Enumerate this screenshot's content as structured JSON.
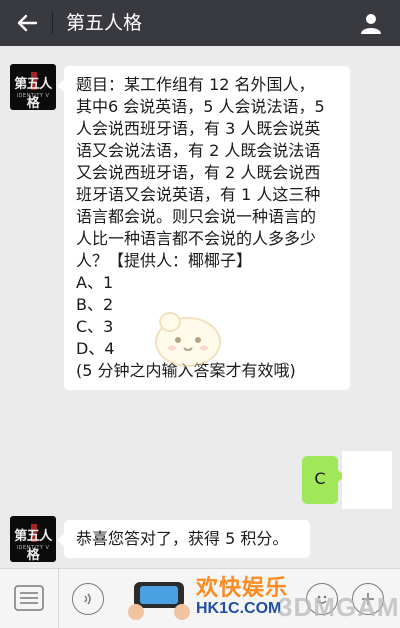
{
  "header": {
    "title": "第五人格",
    "back_icon": "arrow-left-icon",
    "profile_icon": "person-icon"
  },
  "messages": [
    {
      "side": "left",
      "sender_logo": "第五人格",
      "sender_logo_sub": "IDENTITY V",
      "lines": [
        "题目：某工作组有 12 名外国人，",
        "其中6 会说英语，5 人会说法语，5",
        "人会说西班牙语，有 3 人既会说英",
        "语又会说法语，有 2 人既会说法语",
        "又会说西班牙语，有 2 人既会说西",
        "班牙语又会说英语，有 1 人这三种",
        "语言都会说。则只会说一种语言的",
        "人比一种语言都不会说的人多多少",
        "人？【提供人：椰椰子】",
        "A、1",
        "B、2",
        "C、3",
        "D、4",
        "(5 分钟之内输入答案才有效哦)"
      ]
    },
    {
      "side": "right",
      "text": "C"
    },
    {
      "side": "left",
      "sender_logo": "第五人格",
      "sender_logo_sub": "IDENTITY V",
      "text": "恭喜您答对了，获得 5 积分。"
    }
  ],
  "toolbar": {
    "menu_icon": "list-menu-icon",
    "voice_icon": "voice-icon",
    "emoji_icon": "emoji-icon",
    "plus_icon": "plus-icon"
  },
  "watermark": {
    "line1": "欢快娱乐",
    "line2": "HK1C.COM",
    "line3": "3DMGAME"
  },
  "colors": {
    "topbar": "#393a3f",
    "chat_bg": "#ebebeb",
    "sent_bubble": "#a0e75a",
    "received_bubble": "#ffffff"
  }
}
